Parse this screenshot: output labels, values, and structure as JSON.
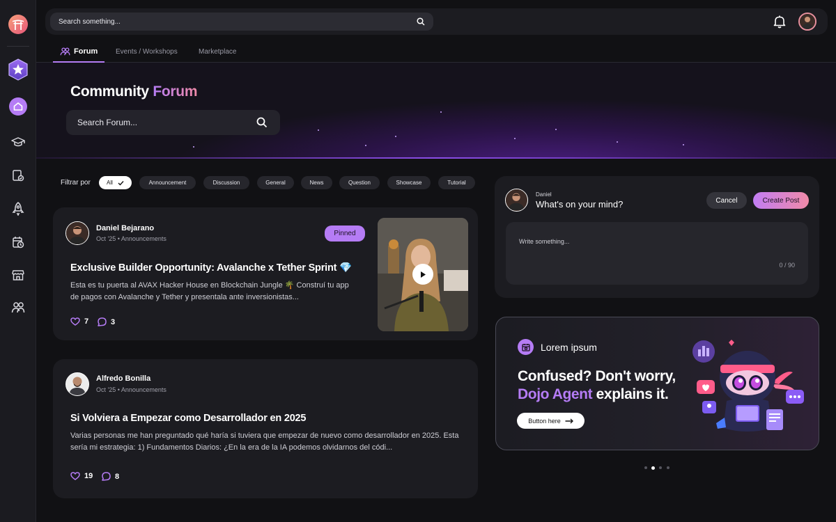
{
  "topbar": {
    "search_placeholder": "Search something..."
  },
  "tabs": [
    {
      "label": "Forum",
      "active": true
    },
    {
      "label": "Events / Workshops",
      "active": false
    },
    {
      "label": "Marketplace",
      "active": false
    }
  ],
  "hero": {
    "title_main": "Community",
    "title_accent": "Forum",
    "search_placeholder": "Search Forum..."
  },
  "filters": {
    "label": "Filtrar por",
    "chips": [
      "All",
      "Announcement",
      "Discussion",
      "General",
      "News",
      "Question",
      "Showcase",
      "Tutorial"
    ],
    "selected": "All"
  },
  "posts": [
    {
      "author": "Daniel Bejarano",
      "date": "Oct '25",
      "category": "Announcements",
      "badge": "Pinned",
      "title": "Exclusive Builder Opportunity: Avalanche x Tether Sprint 💎",
      "excerpt": "Esta es tu puerta al AVAX Hacker House en Blockchain Jungle 🌴 Construí tu app de pagos con Avalanche y Tether y presentala ante inversionistas...",
      "likes": "7",
      "comments": "3"
    },
    {
      "author": "Alfredo Bonilla",
      "date": "Oct '25",
      "category": "Announcements",
      "title": "Si Volviera a Empezar como Desarrollador en 2025",
      "excerpt": "Varias personas me han preguntado qué haría si tuviera que empezar de nuevo como desarrollador en 2025. Esta sería mi estrategia: 1) Fundamentos Diarios: ¿En la era de la IA podemos olvidarnos del códi...",
      "likes": "19",
      "comments": "8"
    }
  ],
  "composer": {
    "user": "Daniel",
    "prompt": "What's on your mind?",
    "cancel_label": "Cancel",
    "create_label": "Create Post",
    "placeholder": "Write something...",
    "counter": "0 / 90"
  },
  "promo": {
    "label": "Lorem ipsum",
    "headline_line1": "Confused? Don't worry,",
    "headline_accent": "Dojo Agent",
    "headline_rest": "explains it.",
    "button_label": "Button here",
    "pager_count": 4,
    "pager_active": 1
  },
  "colors": {
    "accent": "#b57cf5",
    "accent_pink": "#f08aa8",
    "background": "#111114",
    "card": "#1c1c21"
  },
  "icons": [
    "torii-gate-icon",
    "star-badge-icon",
    "home-icon",
    "graduation-cap-icon",
    "certificate-icon",
    "rocket-icon",
    "calendar-clock-icon",
    "store-icon",
    "community-icon",
    "search-icon",
    "bell-icon",
    "heart-icon",
    "comment-icon",
    "play-icon",
    "calendar-icon",
    "arrow-right-icon"
  ]
}
